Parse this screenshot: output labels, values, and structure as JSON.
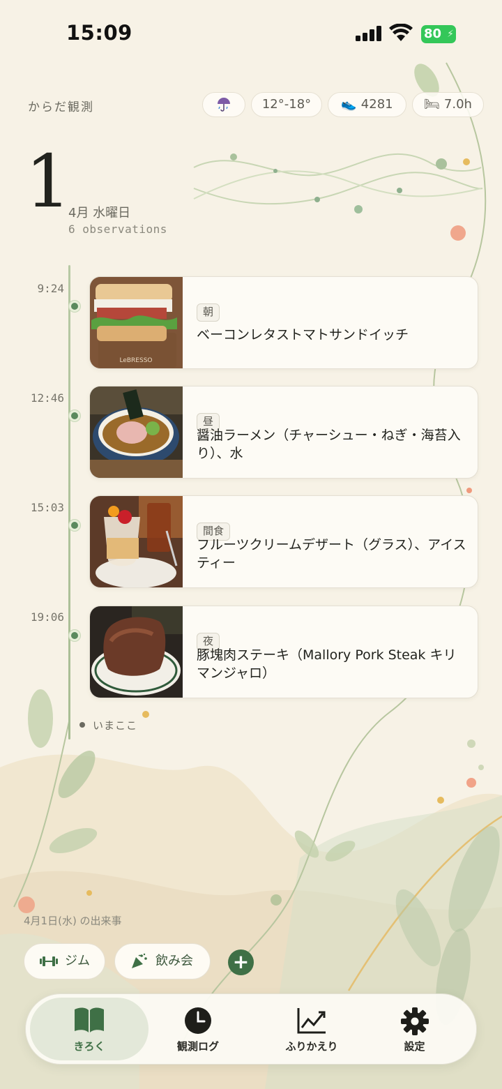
{
  "status_bar": {
    "time": "15:09",
    "battery": "80"
  },
  "header": {
    "app_title": "からだ観測",
    "chips": {
      "weather_icon": "umbrella-rain-icon",
      "temperature": "12°-18°",
      "steps": "4281",
      "sleep": "7.0h"
    },
    "day": "1",
    "date": "4月 水曜日",
    "observations": "6 observations"
  },
  "timeline": {
    "meals": [
      {
        "time": "9:24",
        "tag": "朝",
        "name": "ベーコンレタストマトサンドイッチ"
      },
      {
        "time": "12:46",
        "tag": "昼",
        "name": "醤油ラーメン（チャーシュー・ねぎ・海苔入り）、水"
      },
      {
        "time": "15:03",
        "tag": "間食",
        "name": "フルーツクリームデザート（グラス）、アイスティー"
      },
      {
        "time": "19:06",
        "tag": "夜",
        "name": "豚塊肉ステーキ（Mallory Pork Steak キリマンジャロ）"
      }
    ],
    "now_label": "いまここ"
  },
  "events": {
    "label": "4月1日(水) の出来事",
    "items": [
      {
        "label": "ジム",
        "icon": "dumbbell-icon"
      },
      {
        "label": "飲み会",
        "icon": "party-popper-icon"
      }
    ]
  },
  "tabs": [
    {
      "label": "きろく",
      "icon": "book-icon",
      "active": true
    },
    {
      "label": "観測ログ",
      "icon": "clock-icon"
    },
    {
      "label": "ふりかえり",
      "icon": "chart-line-icon"
    },
    {
      "label": "設定",
      "icon": "gear-icon"
    }
  ],
  "colors": {
    "accent": "#3f7046",
    "background": "#f7f2e6",
    "battery": "#34c759"
  }
}
